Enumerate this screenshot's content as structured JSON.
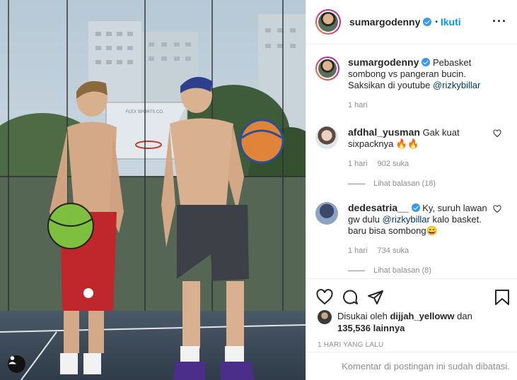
{
  "header": {
    "username": "sumargodenny",
    "follow_label": "Ikuti",
    "bullet": "•",
    "more_label": "•••"
  },
  "caption": {
    "username": "sumargodenny",
    "text_before": "Pebasket sombong vs pangeran bucin.",
    "text_line2": "Saksikan di youtube",
    "mention": "@rizkybillar",
    "time": "1 hari"
  },
  "comments": [
    {
      "username": "afdhal_yusman",
      "verified": false,
      "text": "Gak kuat sixpacknya 🔥🔥",
      "time": "1 hari",
      "likes": "902 suka",
      "replies": "Lihat balasan (18)"
    },
    {
      "username": "dedesatria__",
      "verified": true,
      "text_before": "Ky, suruh lawan gw dulu",
      "mention": "@rizkybillar",
      "text_after": "kalo basket. baru bisa sombong😄",
      "time": "1 hari",
      "likes": "734 suka",
      "replies": "Lihat balasan (8)"
    }
  ],
  "likes": {
    "prefix": "Disukai oleh",
    "user": "dijjah_yelloww",
    "conj": "dan",
    "count": "135,536 lainnya"
  },
  "posted_ago": "1 HARI YANG LALU",
  "comment_restricted": "Komentar di postingan ini sudah dibatasi.",
  "photo": {
    "backboard_text": "FLEX SPORTS CO."
  },
  "colors": {
    "accent": "#0095f6",
    "link": "#00376b",
    "muted": "#8e8e8e",
    "verified": "#3897f0"
  }
}
